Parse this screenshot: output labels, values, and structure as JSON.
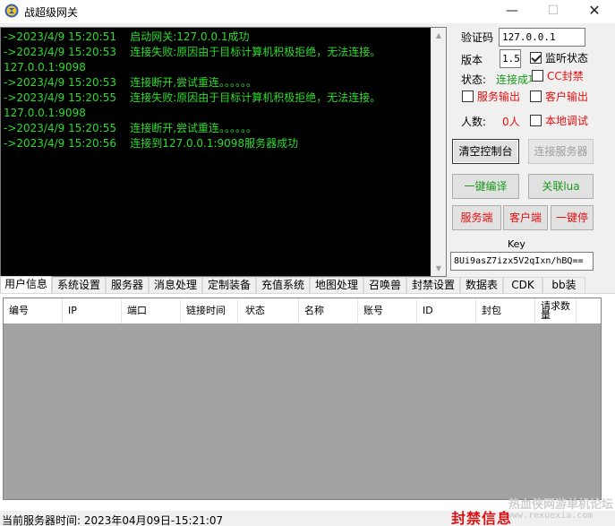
{
  "window": {
    "title": "战超级网关",
    "min": "—",
    "max": "☐",
    "close": "✕"
  },
  "console": {
    "lines": [
      "->2023/4/9 15:20:51    启动网关:127.0.0.1成功",
      "->2023/4/9 15:20:53    连接失败:原因由于目标计算机积极拒绝，无法连接。",
      "127.0.0.1:9098",
      "->2023/4/9 15:20:53    连接断开,尝试重连。。。。。。",
      "->2023/4/9 15:20:55    连接失败:原因由于目标计算机积极拒绝，无法连接。",
      "127.0.0.1:9098",
      "->2023/4/9 15:20:55    连接断开,尝试重连。。。。。。",
      "->2023/4/9 15:20:56    连接到127.0.0.1:9098服务器成功"
    ]
  },
  "panel": {
    "code_label": "验证码",
    "code_value": "127.0.0.1",
    "version_label": "版本",
    "version_value": "1.5",
    "listen_label": "监听状态",
    "status_label": "状态:",
    "status_value": "连接成功",
    "cc_ban_label": "CC封禁",
    "server_output_label": "服务输出",
    "client_output_label": "客户输出",
    "count_label": "人数:",
    "count_value": "0人",
    "local_debug_label": "本地调试",
    "clear_console": "清空控制台",
    "connect_server": "连接服务器",
    "one_click_compile": "一键编译",
    "associate_lua": "关联lua",
    "server_side": "服务端",
    "client_side": "客户端",
    "one_click_stop": "一键停",
    "key_label": "Key",
    "key_value": "8Ui9asZ7izx5V2qIxn/hBQ=="
  },
  "tabs": [
    "用户信息",
    "系统设置",
    "服务器",
    "消息处理",
    "定制装备",
    "充值系统",
    "地图处理",
    "召唤兽",
    "封禁设置",
    "数据表",
    "CDK",
    "bb装"
  ],
  "columns": [
    "编号",
    "IP",
    "端口",
    "链接时间",
    "状态",
    "名称",
    "账号",
    "ID",
    "封包",
    "请求数量"
  ],
  "status": {
    "server_time": "当前服务器时间:  2023年04月09日-15:21:07",
    "ban_info": "封禁信息",
    "watermark1": "热血侠网游单机论坛",
    "watermark2": "www.rexuexia.com"
  },
  "colors": {
    "console_text": "#2cdc2c",
    "accent_red": "#e01010",
    "accent_green": "#1a9a1a"
  }
}
